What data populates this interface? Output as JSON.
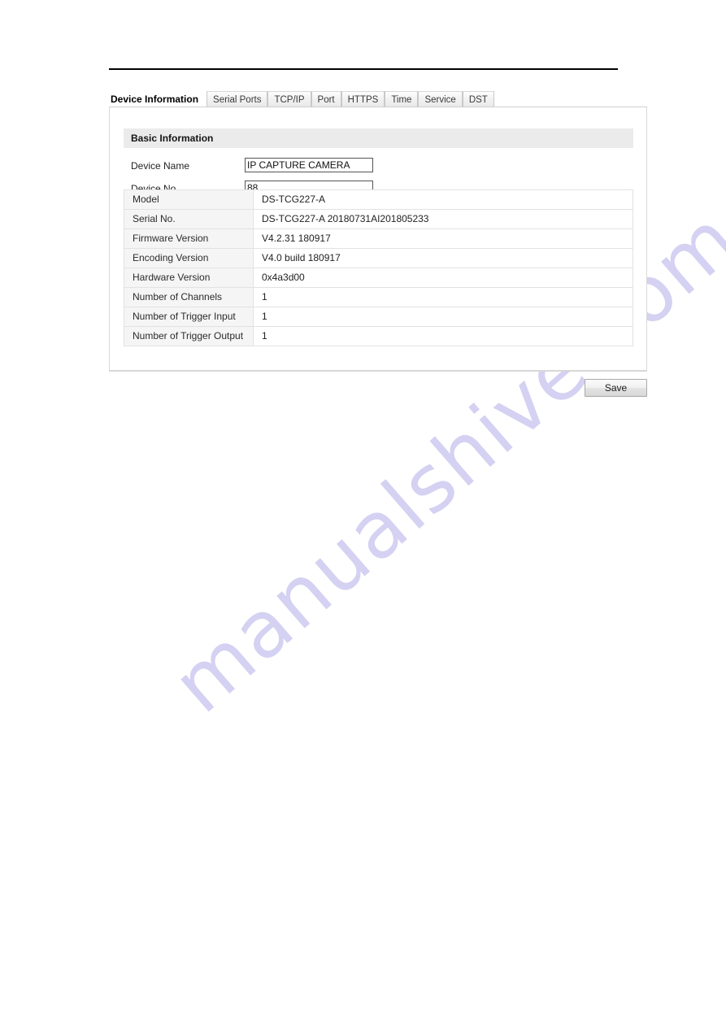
{
  "watermark": {
    "text": "manualshive.com",
    "color": "#d4d1f2"
  },
  "tabs": [
    {
      "label": "Device Information",
      "active": true
    },
    {
      "label": "Serial Ports",
      "active": false
    },
    {
      "label": "TCP/IP",
      "active": false
    },
    {
      "label": "Port",
      "active": false
    },
    {
      "label": "HTTPS",
      "active": false
    },
    {
      "label": "Time",
      "active": false
    },
    {
      "label": "Service",
      "active": false
    },
    {
      "label": "DST",
      "active": false
    }
  ],
  "panel": {
    "section_title": "Basic Information",
    "fields": [
      {
        "label": "Device Name",
        "value": "IP CAPTURE CAMERA"
      },
      {
        "label": "Device No.",
        "value": "88"
      }
    ],
    "info_rows": [
      {
        "key": "Model",
        "value": "DS-TCG227-A"
      },
      {
        "key": "Serial No.",
        "value": "DS-TCG227-A 20180731AI201805233"
      },
      {
        "key": "Firmware Version",
        "value": "V4.2.31 180917"
      },
      {
        "key": "Encoding Version",
        "value": "V4.0 build 180917"
      },
      {
        "key": "Hardware Version",
        "value": "0x4a3d00"
      },
      {
        "key": "Number of Channels",
        "value": "1"
      },
      {
        "key": "Number of Trigger Input",
        "value": "1"
      },
      {
        "key": "Number of Trigger Output",
        "value": "1"
      }
    ]
  },
  "footer": {
    "save_label": "Save"
  }
}
